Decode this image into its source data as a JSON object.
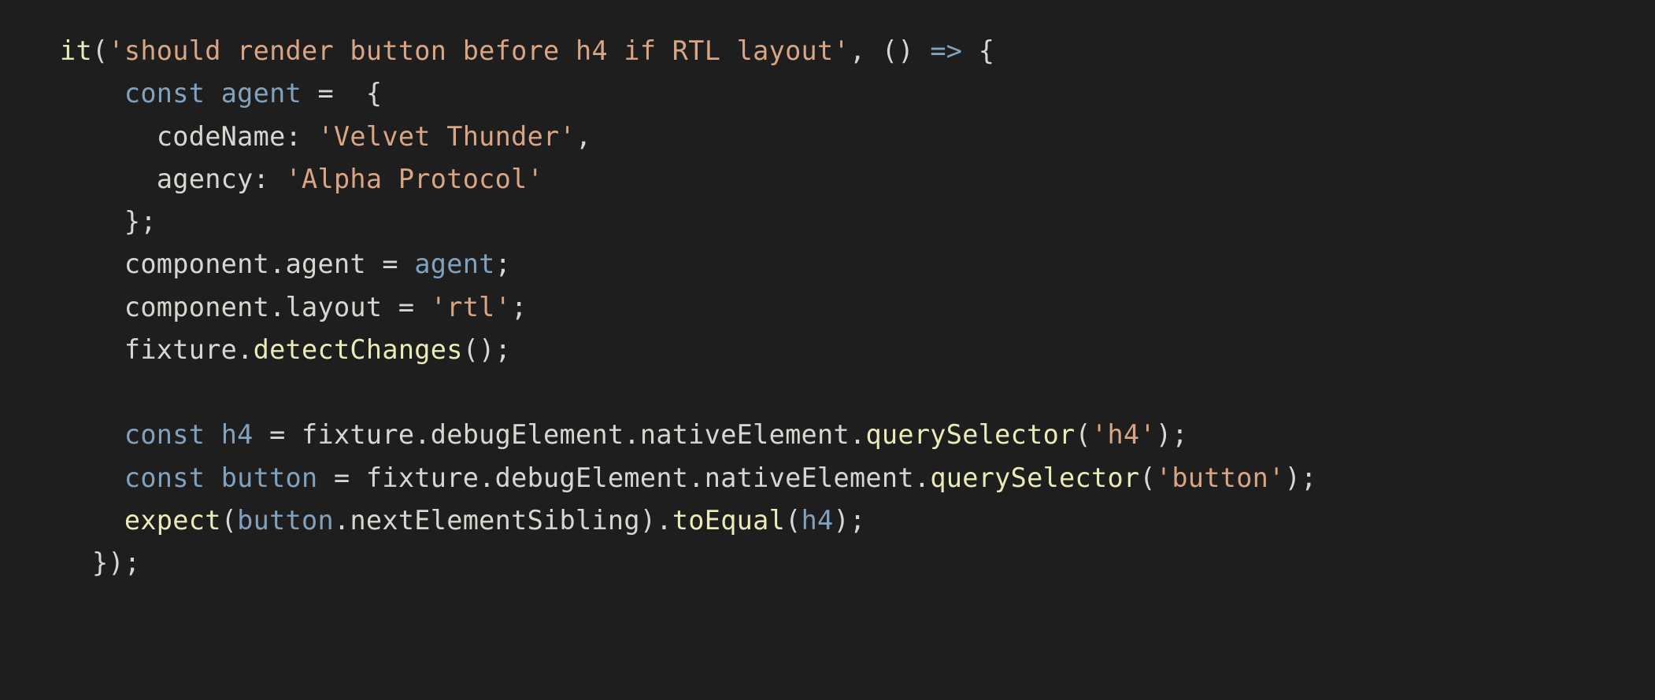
{
  "code": {
    "fn_it": "it",
    "str_testname": "'should render button before h4 if RTL layout'",
    "arrow": "=>",
    "kw_const": "const",
    "var_agent": "agent",
    "prop_codeName": "codeName",
    "str_velvet": "'Velvet Thunder'",
    "prop_agency": "agency",
    "str_alpha": "'Alpha Protocol'",
    "id_component": "component",
    "prop_agent": "agent",
    "prop_layout": "layout",
    "str_rtl": "'rtl'",
    "id_fixture": "fixture",
    "fn_detectChanges": "detectChanges",
    "var_h4": "h4",
    "prop_debugElement": "debugElement",
    "prop_nativeElement": "nativeElement",
    "fn_querySelector": "querySelector",
    "str_h4": "'h4'",
    "var_button": "button",
    "str_button": "'button'",
    "fn_expect": "expect",
    "prop_nextElementSibling": "nextElementSibling",
    "fn_toEqual": "toEqual"
  }
}
